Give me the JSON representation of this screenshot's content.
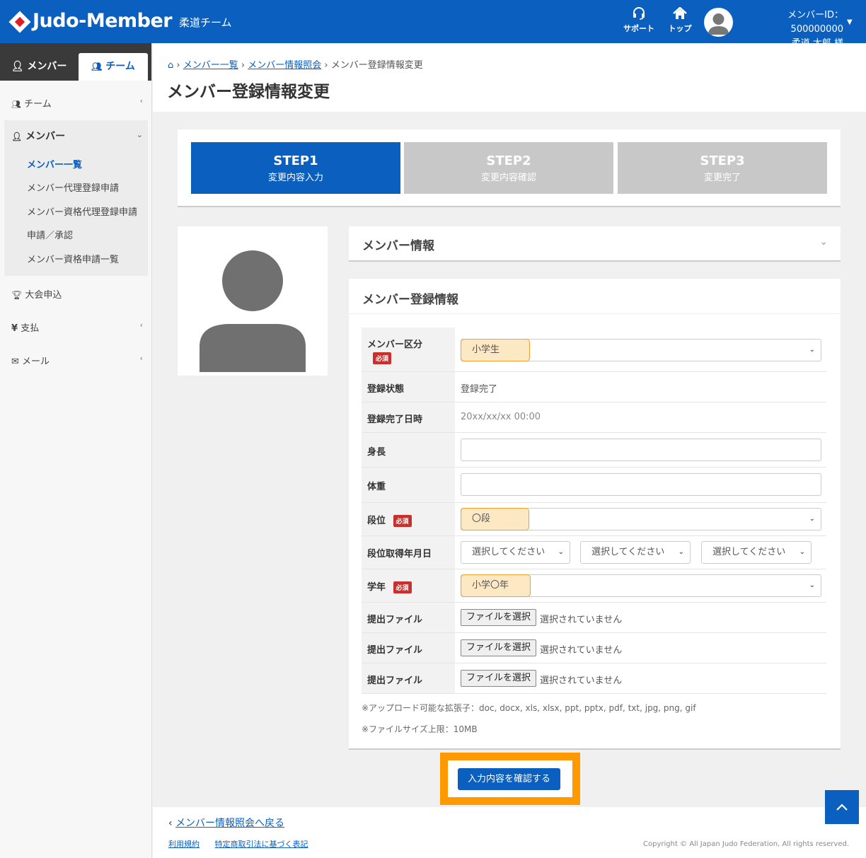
{
  "header": {
    "logo": "Judo-Member",
    "team_name": "柔道チーム",
    "support_label": "サポート",
    "top_label": "トップ",
    "member_id": "メンバーID：500000000",
    "user_name": "柔道 太郎 様"
  },
  "sidebar": {
    "tab_member": "メンバー",
    "tab_team": "チーム",
    "items": {
      "team": "チーム",
      "member": "メンバー",
      "tournament": "大会申込",
      "payment": "支払",
      "mail": "メール"
    },
    "member_sub": [
      "メンバー一覧",
      "メンバー代理登録申請",
      "メンバー資格代理登録申請",
      "申請／承認",
      "メンバー資格申請一覧"
    ]
  },
  "breadcrumb": {
    "item1": "メンバー一覧",
    "item2": "メンバー情報照会",
    "current": "メンバー登録情報変更"
  },
  "page_title": "メンバー登録情報変更",
  "steps": [
    {
      "title": "STEP1",
      "sub": "変更内容入力"
    },
    {
      "title": "STEP2",
      "sub": "変更内容確認"
    },
    {
      "title": "STEP3",
      "sub": "変更完了"
    }
  ],
  "member_info_title": "メンバー情報",
  "reg_title": "メンバー登録情報",
  "required_label": "必須",
  "form": {
    "member_type_label": "メンバー区分",
    "member_type_value": "小学生",
    "reg_status_label": "登録状態",
    "reg_status_value": "登録完了",
    "reg_date_label": "登録完了日時",
    "reg_date_value": "20xx/xx/xx 00:00",
    "height_label": "身長",
    "weight_label": "体重",
    "dan_label": "段位",
    "dan_value": "〇段",
    "dan_date_label": "段位取得年月日",
    "select_placeholder": "選択してください",
    "grade_label": "学年",
    "grade_value": "小学〇年",
    "file_label": "提出ファイル",
    "file_button": "ファイルを選択",
    "file_none": "選択されていません"
  },
  "notes": {
    "extensions": "※アップロード可能な拡張子：doc, docx, xls, xlsx, ppt, pptx, pdf, txt, jpg, png, gif",
    "size": "※ファイルサイズ上限：10MB"
  },
  "confirm_button": "入力内容を確認する",
  "footer": {
    "back_link": "メンバー情報照会へ戻る",
    "terms": "利用規約",
    "commerce": "特定商取引法に基づく表記",
    "copyright": "Copyright © All Japan Judo Federation, All rights reserved."
  },
  "colors": {
    "primary": "#0b5fbf",
    "required": "#c9302c",
    "highlight": "#ff9900"
  }
}
